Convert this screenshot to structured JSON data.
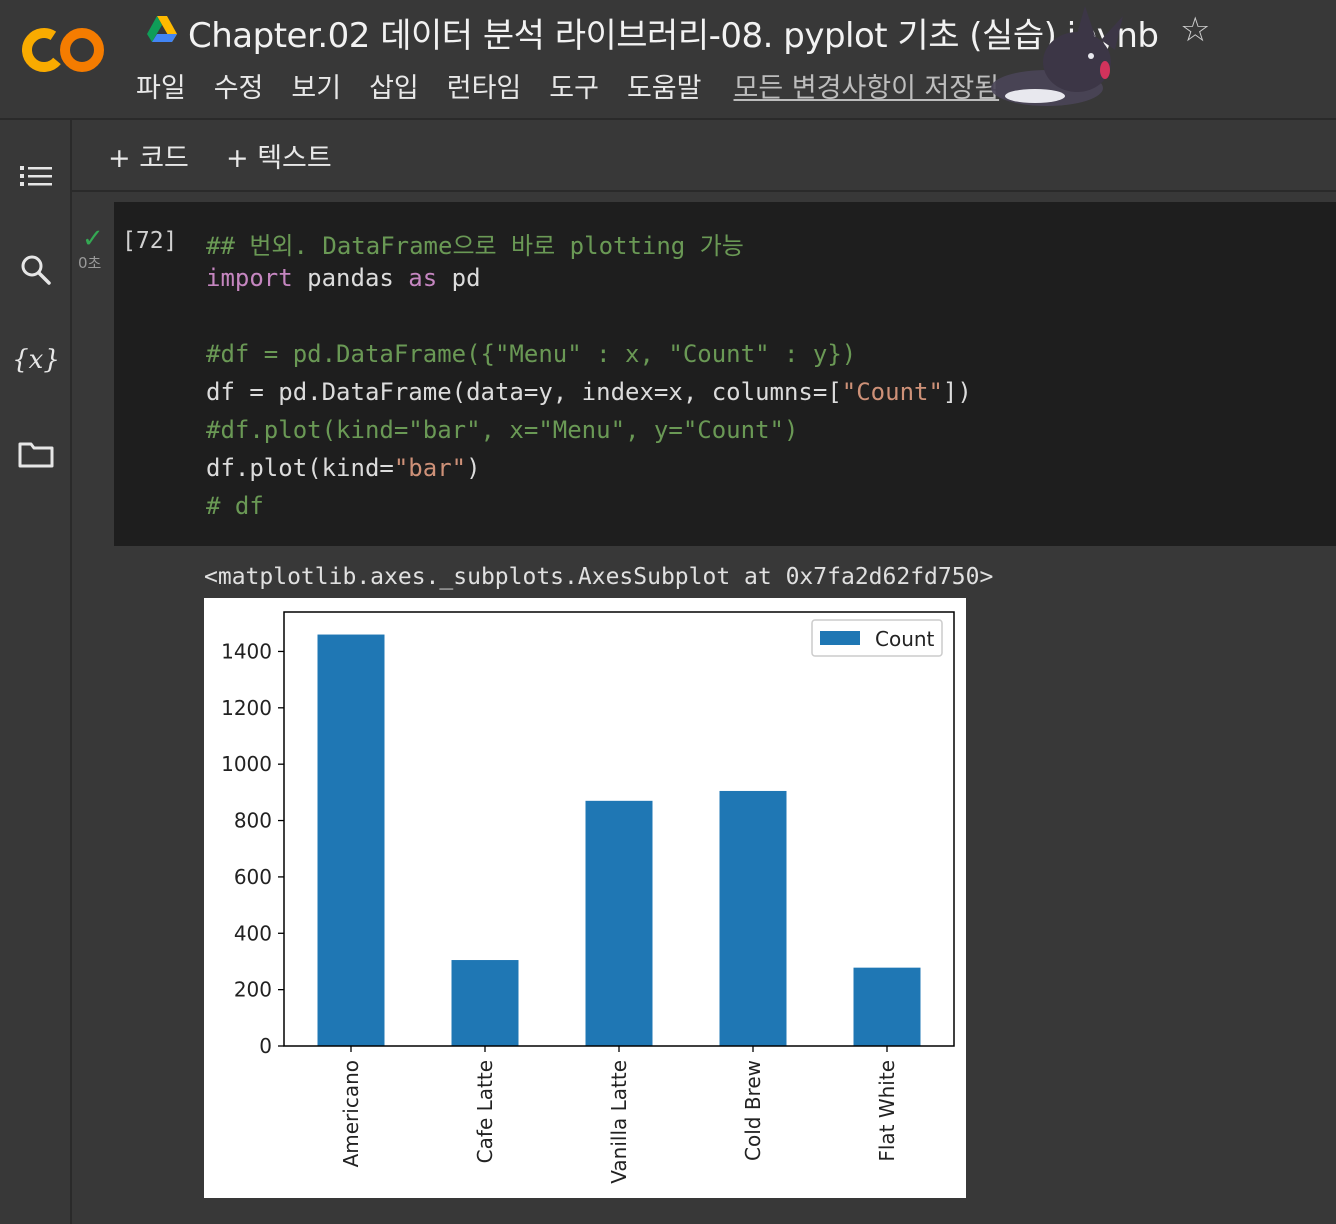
{
  "header": {
    "title": "Chapter.02 데이터 분석 라이브러리-08. pyplot 기초 (실습).ipynb",
    "logo_text": "CO",
    "menu": [
      "파일",
      "수정",
      "보기",
      "삽입",
      "런타임",
      "도구",
      "도움말"
    ],
    "saved_status": "모든 변경사항이 저장됨"
  },
  "toolbar": {
    "add_code": "+ 코드",
    "add_text": "+ 텍스트"
  },
  "cell": {
    "exec_count": "[72]",
    "run_time": "0초",
    "code": [
      {
        "parts": [
          {
            "t": "## 번외. DataFrame으로 바로 plotting 가능",
            "c": "cm"
          }
        ]
      },
      {
        "parts": [
          {
            "t": "import",
            "c": "kw"
          },
          {
            "t": " pandas ",
            "c": ""
          },
          {
            "t": "as",
            "c": "kw"
          },
          {
            "t": " pd",
            "c": ""
          }
        ]
      },
      {
        "parts": []
      },
      {
        "parts": [
          {
            "t": "#df = pd.DataFrame({\"Menu\" : x, \"Count\" : y})",
            "c": "cm"
          }
        ]
      },
      {
        "parts": [
          {
            "t": "df = pd.DataFrame(data=y, index=x, columns=[",
            "c": ""
          },
          {
            "t": "\"Count\"",
            "c": "st"
          },
          {
            "t": "])",
            "c": ""
          }
        ]
      },
      {
        "parts": [
          {
            "t": "#df.plot(kind=\"bar\", x=\"Menu\", y=\"Count\")",
            "c": "cm"
          }
        ]
      },
      {
        "parts": [
          {
            "t": "df.plot(kind=",
            "c": ""
          },
          {
            "t": "\"bar\"",
            "c": "st"
          },
          {
            "t": ")",
            "c": ""
          }
        ]
      },
      {
        "parts": [
          {
            "t": "# df",
            "c": "cm"
          }
        ]
      }
    ],
    "output_repr": "<matplotlib.axes._subplots.AxesSubplot at 0x7fa2d62fd750>"
  },
  "colors": {
    "bar": "#1f77b4",
    "comment": "#6a9955",
    "keyword": "#c586c0",
    "string": "#ce9178",
    "check": "#34a853"
  },
  "chart_data": {
    "type": "bar",
    "categories": [
      "Americano",
      "Cafe Latte",
      "Vanilla Latte",
      "Cold Brew",
      "Flat White"
    ],
    "series": [
      {
        "name": "Count",
        "values": [
          1460,
          305,
          870,
          905,
          278
        ]
      }
    ],
    "ylim": [
      0,
      1540
    ],
    "yticks": [
      0,
      200,
      400,
      600,
      800,
      1000,
      1200,
      1400
    ],
    "legend": "top-right",
    "grid": false
  }
}
